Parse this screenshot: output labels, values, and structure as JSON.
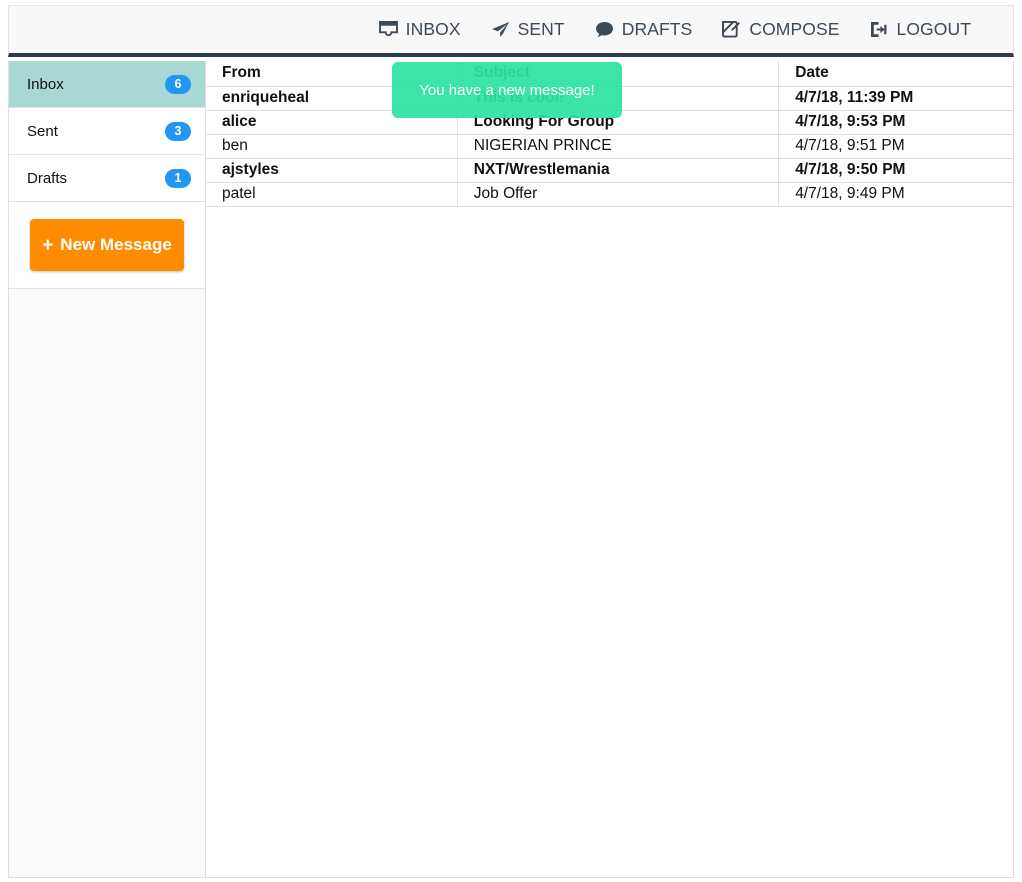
{
  "navbar": {
    "items": [
      {
        "label": "INBOX",
        "icon": "inbox-icon"
      },
      {
        "label": "SENT",
        "icon": "paper-plane-icon"
      },
      {
        "label": "DRAFTS",
        "icon": "comment-icon"
      },
      {
        "label": "COMPOSE",
        "icon": "pen-square-icon"
      },
      {
        "label": "LOGOUT",
        "icon": "sign-out-icon"
      }
    ]
  },
  "sidebar": {
    "folders": [
      {
        "label": "Inbox",
        "count": "6",
        "active": true
      },
      {
        "label": "Sent",
        "count": "3",
        "active": false
      },
      {
        "label": "Drafts",
        "count": "1",
        "active": false
      }
    ],
    "new_message_button": {
      "label": "New Message",
      "plus": "+"
    }
  },
  "mail_table": {
    "headers": {
      "from": "From",
      "subject": "Subject",
      "date": "Date"
    },
    "rows": [
      {
        "from": "enriqueheal",
        "subject": "This is cool!",
        "date": "4/7/18, 11:39 PM",
        "unread": true
      },
      {
        "from": "alice",
        "subject": "Looking For Group",
        "date": "4/7/18, 9:53 PM",
        "unread": true
      },
      {
        "from": "ben",
        "subject": "NIGERIAN PRINCE",
        "date": "4/7/18, 9:51 PM",
        "unread": false
      },
      {
        "from": "ajstyles",
        "subject": "NXT/Wrestlemania",
        "date": "4/7/18, 9:50 PM",
        "unread": true
      },
      {
        "from": "patel",
        "subject": "Job Offer",
        "date": "4/7/18, 9:49 PM",
        "unread": false
      }
    ]
  },
  "toast": {
    "message": "You have a new message!"
  },
  "colors": {
    "navbar_bg": "#f8f8f8",
    "navbar_border_bottom": "#2c3e50",
    "active_folder": "#a8d8d3",
    "badge": "#2196f3",
    "new_message_button": "#ff8c00",
    "toast": "#2de2a1",
    "text": "#111111",
    "nav_text": "#3c4a58"
  }
}
